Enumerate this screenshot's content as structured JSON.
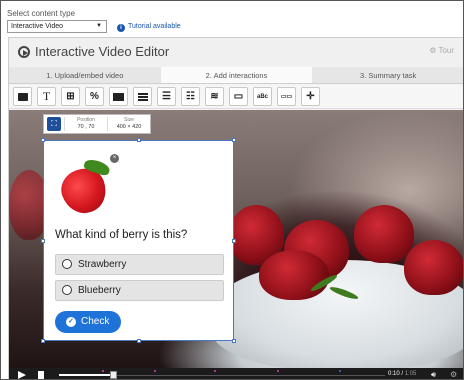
{
  "content_type": {
    "label": "Select content type",
    "selected": "Interactive Video",
    "tutorial": "Tutorial available"
  },
  "editor": {
    "title": "Interactive Video Editor",
    "tour": "Tour"
  },
  "tabs": [
    {
      "label": "1. Upload/embed video",
      "active": false
    },
    {
      "label": "2. Add interactions",
      "active": true
    },
    {
      "label": "3. Summary task",
      "active": false
    }
  ],
  "toolbar": {
    "tools": [
      {
        "name": "label-tool",
        "icon": "label-icon"
      },
      {
        "name": "text-tool",
        "icon": "text-icon",
        "glyph": "T"
      },
      {
        "name": "table-tool",
        "icon": "table-icon"
      },
      {
        "name": "link-tool",
        "icon": "link-icon"
      },
      {
        "name": "image-tool",
        "icon": "image-icon"
      },
      {
        "name": "statements-tool",
        "icon": "statements-icon"
      },
      {
        "name": "single-choice-tool",
        "icon": "single-choice-icon"
      },
      {
        "name": "multiple-choice-tool",
        "icon": "multiple-choice-icon"
      },
      {
        "name": "true-false-tool",
        "icon": "true-false-icon"
      },
      {
        "name": "fill-blanks-tool",
        "icon": "fill-blanks-icon"
      },
      {
        "name": "drag-text-tool",
        "icon": "drag-text-icon"
      },
      {
        "name": "mark-words-tool",
        "icon": "mark-words-icon"
      },
      {
        "name": "crossroads-tool",
        "icon": "crossroads-icon"
      }
    ]
  },
  "interaction": {
    "position_label": "Position",
    "position_value": "70 , 70",
    "size_label": "Size",
    "size_value": "400 × 420",
    "question": "What kind of berry is this?",
    "options": [
      "Strawberry",
      "Blueberry"
    ],
    "check_label": "Check"
  },
  "player": {
    "current_time": "0:10",
    "duration": "1:05",
    "progress": 0.15
  },
  "colors": {
    "accent": "#1f72d8",
    "selection_border": "#4a78c2",
    "link": "#1a55b0"
  }
}
